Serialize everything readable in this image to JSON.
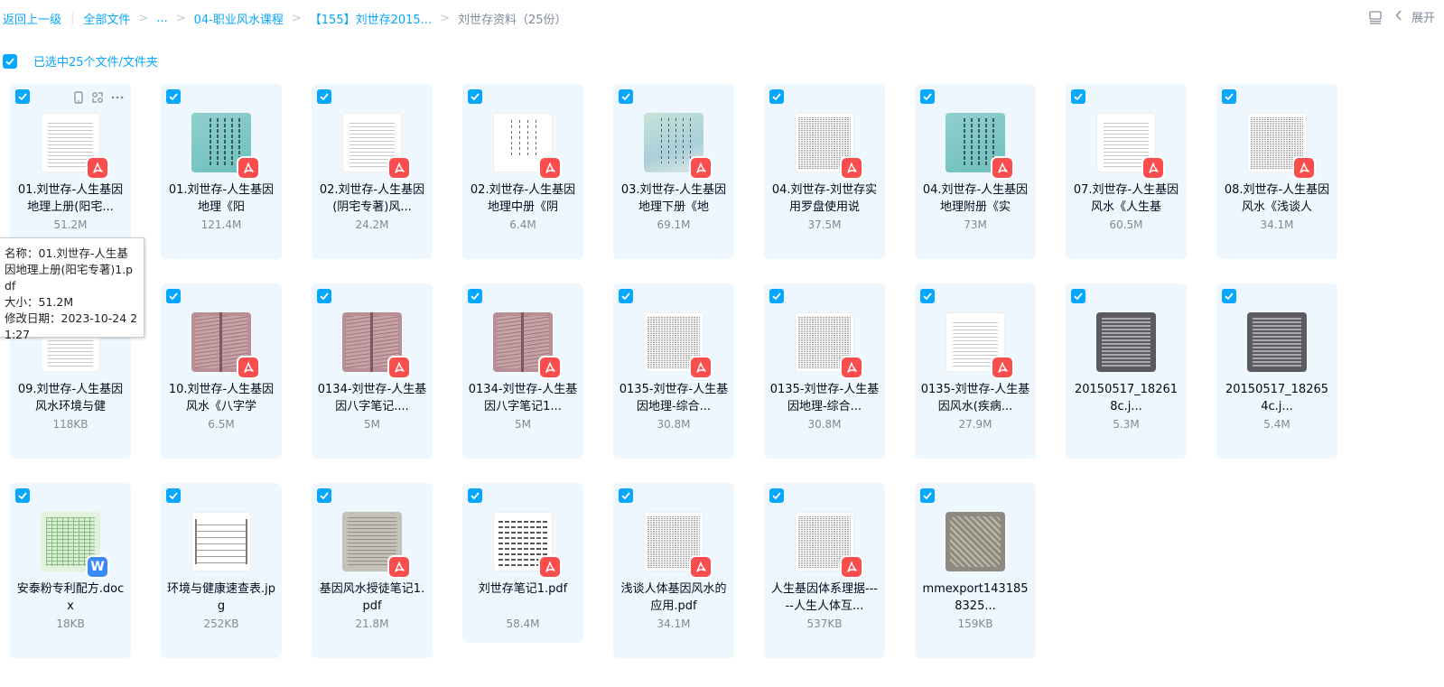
{
  "breadcrumb": {
    "back": "返回上一级",
    "items": [
      "全部文件",
      "...",
      "04-职业风水课程",
      "【155】刘世存2015...",
      "刘世存资料（25份）"
    ]
  },
  "toolbar": {
    "expand": "展开",
    "list_view_icon": "list-view-icon",
    "chevron_icon": "chevron-left-icon"
  },
  "selection": {
    "label": "已选中25个文件/文件夹"
  },
  "tooltip": {
    "name": "名称：01.刘世存-人生基因地理上册(阳宅专著)1.pdf",
    "size": "大小：51.2M",
    "date": "修改日期：2023-10-24 21:27"
  },
  "colors": {
    "accent": "#06a7ff",
    "card_bg": "#eef7fe",
    "pdf_badge": "#fa4e4e",
    "word_badge": "#3a8bf8"
  },
  "files": [
    {
      "name": "01.刘世存-人生基因地理上册(阳宅...",
      "size": "51.2M",
      "thumb": "doc-white",
      "type": "pdf"
    },
    {
      "name": "01.刘世存-人生基因地理《阳",
      "size": "121.4M",
      "thumb": "teal",
      "type": "pdf"
    },
    {
      "name": "02.刘世存-人生基因(阴宅专著)风...",
      "size": "24.2M",
      "thumb": "doc-white",
      "type": "pdf"
    },
    {
      "name": "02.刘世存-人生基因地理中册《阴",
      "size": "6.4M",
      "thumb": "vertical-doc",
      "type": "pdf"
    },
    {
      "name": "03.刘世存-人生基因地理下册《地",
      "size": "69.1M",
      "thumb": "sky",
      "type": "pdf"
    },
    {
      "name": "04.刘世存-刘世存实用罗盘使用说",
      "size": "37.5M",
      "thumb": "dense-doc",
      "type": "pdf"
    },
    {
      "name": "04.刘世存-人生基因地理附册《实",
      "size": "73M",
      "thumb": "teal",
      "type": "pdf"
    },
    {
      "name": "07.刘世存-人生基因风水《人生基",
      "size": "60.5M",
      "thumb": "doc-white",
      "type": "pdf"
    },
    {
      "name": "08.刘世存-人生基因风水《浅谈人",
      "size": "34.1M",
      "thumb": "dense-doc",
      "type": "pdf"
    },
    {
      "name": "09.刘世存-人生基因风水环境与健",
      "size": "118KB",
      "thumb": "doc-white",
      "type": "none"
    },
    {
      "name": "10.刘世存-人生基因风水《八字学",
      "size": "6.5M",
      "thumb": "rose",
      "type": "pdf"
    },
    {
      "name": "0134-刘世存-人生基因八字笔记....",
      "size": "5M",
      "thumb": "rose",
      "type": "pdf"
    },
    {
      "name": "0134-刘世存-人生基因八字笔记1...",
      "size": "5M",
      "thumb": "rose",
      "type": "pdf"
    },
    {
      "name": "0135-刘世存-人生基因地理-综合...",
      "size": "30.8M",
      "thumb": "dense-doc",
      "type": "pdf"
    },
    {
      "name": "0135-刘世存-人生基因地理-综合...",
      "size": "30.8M",
      "thumb": "dense-doc",
      "type": "pdf"
    },
    {
      "name": "0135-刘世存-人生基因风水(疾病...",
      "size": "27.9M",
      "thumb": "doc-white",
      "type": "pdf"
    },
    {
      "name": "20150517_182618c.j...",
      "size": "5.3M",
      "thumb": "photo-gray",
      "type": "none"
    },
    {
      "name": "20150517_182654c.j...",
      "size": "5.4M",
      "thumb": "photo-gray",
      "type": "none"
    },
    {
      "name": "安泰粉专利配方.docx",
      "size": "18KB",
      "thumb": "green-table",
      "type": "doc"
    },
    {
      "name": "环境与健康速查表.jpg",
      "size": "252KB",
      "thumb": "form-doc",
      "type": "none"
    },
    {
      "name": "基因风水授徒笔记1.pdf",
      "size": "21.8M",
      "thumb": "paper-photo",
      "type": "pdf"
    },
    {
      "name": "刘世存笔记1.pdf",
      "size": "58.4M",
      "thumb": "hand-doc",
      "type": "pdf",
      "short": true
    },
    {
      "name": "浅谈人体基因风水的应用.pdf",
      "size": "34.1M",
      "thumb": "dense-doc",
      "type": "pdf"
    },
    {
      "name": "人生基因体系理据-----人生人体互...",
      "size": "537KB",
      "thumb": "dense-doc",
      "type": "pdf"
    },
    {
      "name": "mmexport1431858325...",
      "size": "159KB",
      "thumb": "sketch-photo",
      "type": "none"
    }
  ]
}
